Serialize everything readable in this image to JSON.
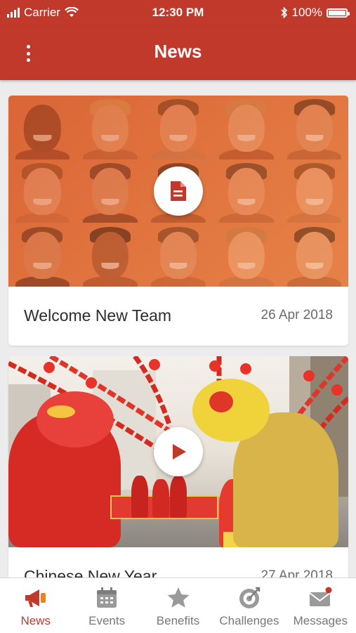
{
  "status_bar": {
    "carrier": "Carrier",
    "time": "12:30 PM",
    "battery": "100%"
  },
  "header": {
    "title": "News"
  },
  "news": [
    {
      "title": "Welcome New Team",
      "date": "26 Apr 2018",
      "type_icon": "document-icon"
    },
    {
      "title": "Chinese New Year",
      "date": "27 Apr 2018",
      "type_icon": "play-icon"
    }
  ],
  "tabs": [
    {
      "label": "News",
      "icon": "megaphone-icon",
      "active": true
    },
    {
      "label": "Events",
      "icon": "calendar-icon",
      "active": false
    },
    {
      "label": "Benefits",
      "icon": "star-icon",
      "active": false
    },
    {
      "label": "Challenges",
      "icon": "target-icon",
      "active": false
    },
    {
      "label": "Messages",
      "icon": "envelope-icon",
      "active": false,
      "notification_dot": true
    }
  ],
  "colors": {
    "accent": "#c0392b",
    "inactive": "#8e8e8e"
  }
}
